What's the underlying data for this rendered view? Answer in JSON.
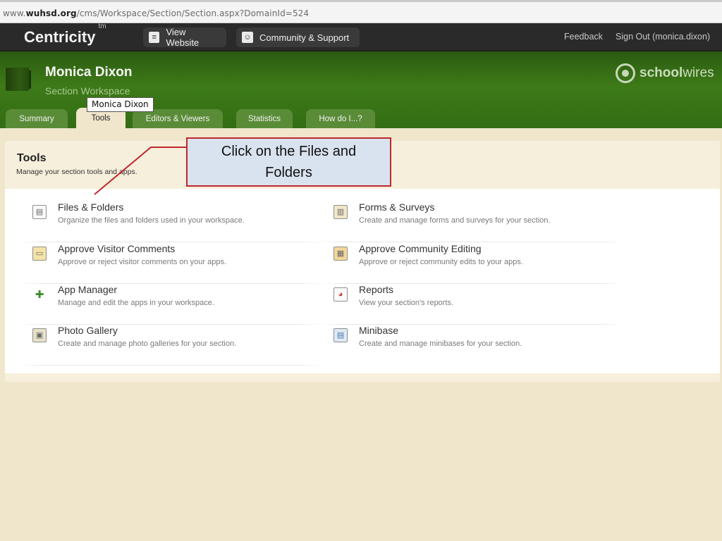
{
  "browser": {
    "url_prefix": "www.",
    "url_domain": "wuhsd.org",
    "url_path": "/cms/Workspace/Section/Section.aspx?DomainId=524"
  },
  "topnav": {
    "brand": "Centricity",
    "brand_mark": "tm",
    "view_website": "View Website",
    "community_support": "Community & Support",
    "feedback": "Feedback",
    "sign_out": "Sign Out (monica.dixon)"
  },
  "header": {
    "name": "Monica Dixon",
    "subtitle": "Section Workspace",
    "logo_bold": "school",
    "logo_light": "wires"
  },
  "tooltip": "Monica Dixon",
  "tabs": {
    "summary": "Summary",
    "tools": "Tools",
    "editors": "Editors & Viewers",
    "statistics": "Statistics",
    "howdo": "How do I...?"
  },
  "tools": {
    "title": "Tools",
    "description": "Manage your section tools and apps."
  },
  "items": [
    {
      "label": "Files & Folders",
      "desc": "Organize the files and folders used in your workspace.",
      "icon": "files-folders-icon"
    },
    {
      "label": "Forms & Surveys",
      "desc": "Create and manage forms and surveys for your section.",
      "icon": "forms-surveys-icon"
    },
    {
      "label": "Approve Visitor Comments",
      "desc": "Approve or reject visitor comments on your apps.",
      "icon": "comments-icon"
    },
    {
      "label": "Approve Community Editing",
      "desc": "Approve or reject community edits to your apps.",
      "icon": "community-editing-icon"
    },
    {
      "label": "App Manager",
      "desc": "Manage and edit the apps in your workspace.",
      "icon": "puzzle-icon"
    },
    {
      "label": "Reports",
      "desc": "View your section's reports.",
      "icon": "reports-icon"
    },
    {
      "label": "Photo Gallery",
      "desc": "Create and manage photo galleries for your section.",
      "icon": "photo-gallery-icon"
    },
    {
      "label": "Minibase",
      "desc": "Create and manage minibases for your section.",
      "icon": "minibase-icon"
    }
  ],
  "callout": "Click on the Files and Folders",
  "colors": {
    "accent_green": "#3d7a18",
    "callout_border": "#c0272d",
    "callout_fill": "#d9e3ef",
    "page_bg": "#f0e6cc"
  }
}
